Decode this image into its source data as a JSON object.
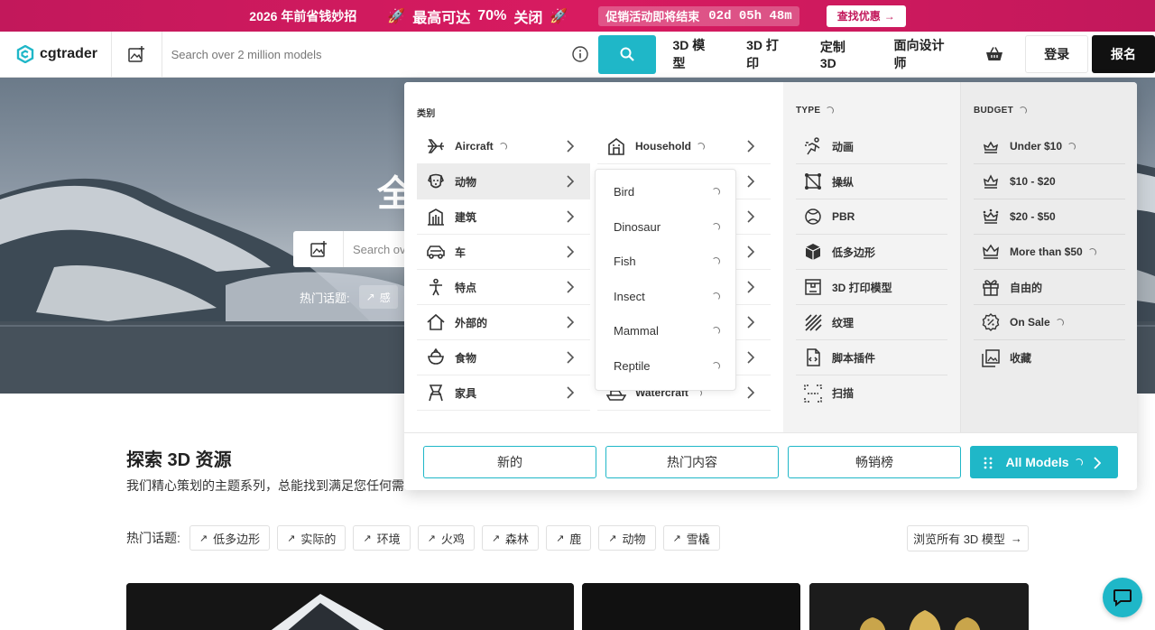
{
  "promo": {
    "lead": "2026 年前省钱妙招",
    "headline": "最高可达",
    "percent": "70%",
    "closing": "关闭",
    "ending": "促销活动即将结束",
    "countdown": "02d 05h 48m",
    "cta": "查找优惠"
  },
  "header": {
    "brand": "cgtrader",
    "search_placeholder": "Search over 2 million models",
    "nav": [
      "3D 模型",
      "3D 打印",
      "定制 3D",
      "面向设计师"
    ],
    "login": "登录",
    "signup": "报名"
  },
  "hero": {
    "title_partial": "全",
    "search_placeholder": "Search ov",
    "hot_label": "热门话题:",
    "hot_chip": "感"
  },
  "mega": {
    "category_heading": "类别",
    "type_heading": "TYPE",
    "budget_heading": "BUDGET",
    "categories_left": [
      "Aircraft",
      "动物",
      "建筑",
      "车",
      "特点",
      "外部的",
      "食物",
      "家具"
    ],
    "categories_right": [
      "Household",
      "Watercraft"
    ],
    "animal_sub": [
      "Bird",
      "Dinosaur",
      "Fish",
      "Insect",
      "Mammal",
      "Reptile"
    ],
    "types": [
      "动画",
      "操纵",
      "PBR",
      "低多边形",
      "3D 打印模型",
      "纹理",
      "脚本插件",
      "扫描"
    ],
    "budgets": [
      "Under $10",
      "$10 - $20",
      "$20 - $50",
      "More than $50",
      "自由的",
      "On Sale",
      "收藏"
    ],
    "buttons": {
      "new": "新的",
      "trending": "热门内容",
      "bestsellers": "畅销榜",
      "all": "All Models"
    }
  },
  "explore": {
    "title": "探索 3D 资源",
    "subtitle": "我们精心策划的主题系列，总能找到满足您任何需",
    "hot_label": "热门话题:",
    "tags": [
      "低多边形",
      "实际的",
      "环境",
      "火鸡",
      "森林",
      "鹿",
      "动物",
      "雪橇"
    ],
    "browse_all": "浏览所有 3D 模型"
  },
  "colors": {
    "accent": "#1fb7c8",
    "promo": "#d81b60",
    "dark": "#111111"
  }
}
